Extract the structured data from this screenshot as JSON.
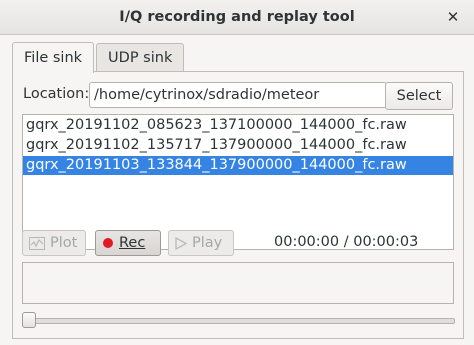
{
  "window": {
    "title": "I/Q recording and replay tool"
  },
  "tabs": [
    {
      "label": "File sink",
      "active": true
    },
    {
      "label": "UDP sink",
      "active": false
    }
  ],
  "location": {
    "label": "Location:",
    "value": "/home/cytrinox/sdradio/meteor",
    "select_label": "Select"
  },
  "files": [
    "gqrx_20191102_085623_137100000_144000_fc.raw",
    "gqrx_20191102_135717_137900000_144000_fc.raw",
    "gqrx_20191103_133844_137900000_144000_fc.raw"
  ],
  "selected_file_index": 2,
  "controls": {
    "plot_label": "Plot",
    "rec_label": "Rec",
    "play_label": "Play",
    "time": "00:00:00 / 00:00:03"
  },
  "playback_position": 0,
  "colors": {
    "selection": "#3584e4",
    "record": "#e01b24"
  }
}
